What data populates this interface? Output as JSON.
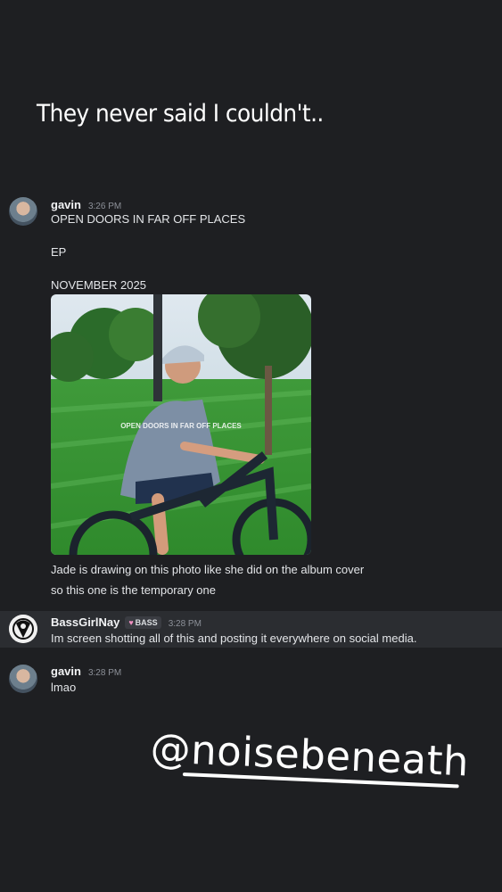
{
  "story": {
    "caption": "They never said I couldn't.."
  },
  "messages": [
    {
      "username": "gavin",
      "time": "3:26 PM",
      "lines": [
        "OPEN DOORS IN FAR OFF PLACES",
        "EP",
        "NOVEMBER 2025"
      ],
      "image_caption": "OPEN DOORS IN FAR OFF PLACES",
      "after_lines": [
        "Jade is drawing on this photo like she did on the album cover",
        "so this one is the temporary one"
      ]
    },
    {
      "username": "BassGirlNay",
      "badge": "BASS",
      "time": "3:28 PM",
      "lines": [
        "Im screen shotting all of this and posting it everywhere on social media."
      ]
    },
    {
      "username": "gavin",
      "time": "3:28 PM",
      "lines": [
        "lmao"
      ]
    }
  ],
  "overlay": {
    "handle": "noisebeneath",
    "icon": "threads-icon"
  },
  "colors": {
    "background": "#1e1f22",
    "highlight": "#2b2d31",
    "text": "#dbdee1"
  }
}
